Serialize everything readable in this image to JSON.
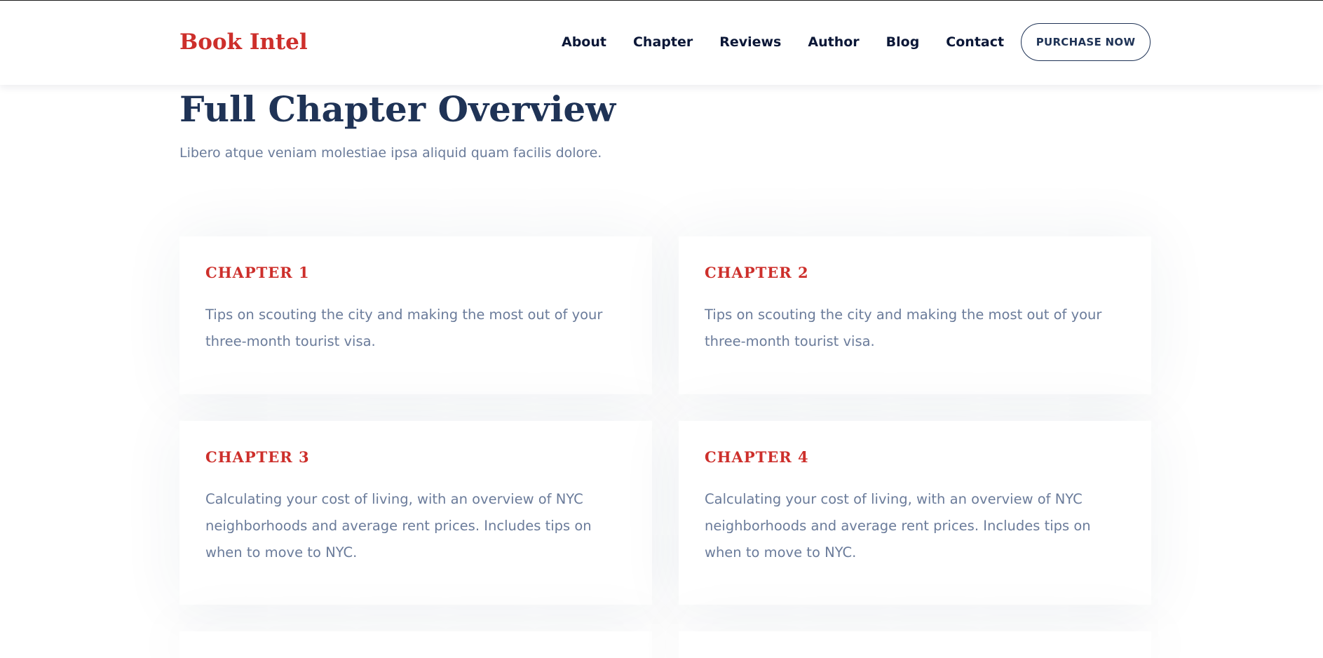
{
  "brand": {
    "name": "Book Intel"
  },
  "nav": {
    "links": [
      {
        "label": "About"
      },
      {
        "label": "Chapter"
      },
      {
        "label": "Reviews"
      },
      {
        "label": "Author"
      },
      {
        "label": "Blog"
      },
      {
        "label": "Contact"
      }
    ],
    "cta_label": "PURCHASE NOW"
  },
  "section": {
    "title": "Full Chapter Overview",
    "subtitle": "Libero atque veniam molestiae ipsa aliquid quam facilis dolore."
  },
  "chapters": [
    {
      "title": "CHAPTER 1",
      "text": "Tips on scouting the city and making the most out of your three-month tourist visa."
    },
    {
      "title": "CHAPTER 2",
      "text": "Tips on scouting the city and making the most out of your three-month tourist visa."
    },
    {
      "title": "CHAPTER 3",
      "text": "Calculating your cost of living, with an overview of NYC neighborhoods and average rent prices. Includes tips on when to move to NYC."
    },
    {
      "title": "CHAPTER 4",
      "text": "Calculating your cost of living, with an overview of NYC neighborhoods and average rent prices. Includes tips on when to move to NYC."
    }
  ],
  "colors": {
    "brand_red": "#cd2f2b",
    "navy": "#1f3356",
    "nav_text": "#0b1737",
    "body_text": "#6a7b9a"
  }
}
